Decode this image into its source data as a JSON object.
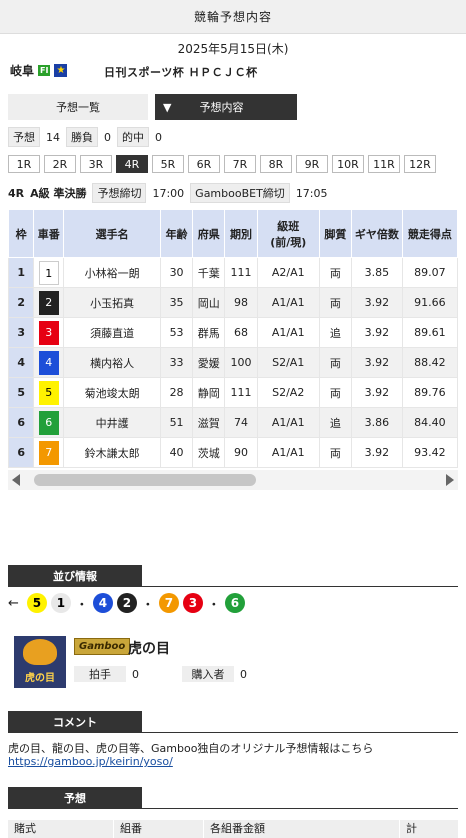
{
  "header": {
    "title": "競輪予想内容"
  },
  "date": "2025年5月15日(木)",
  "venue": {
    "name": "岐阜",
    "grade_badge": "FI",
    "star": "★",
    "cup": "日刊スポーツ杯 ＨＰＣＪＣ杯"
  },
  "tabs": {
    "list": "予想一覧",
    "detail_arrow": "▼",
    "detail": "予想内容"
  },
  "stats": {
    "yoso_label": "予想",
    "yoso": "14",
    "win_label": "勝負",
    "win": "0",
    "hit_label": "的中",
    "hit": "0"
  },
  "races": [
    "1R",
    "2R",
    "3R",
    "4R",
    "5R",
    "6R",
    "7R",
    "8R",
    "9R",
    "10R",
    "11R",
    "12R"
  ],
  "active_race": "4R",
  "raceinfo": {
    "race": "4R",
    "class": "A級 準決勝",
    "deadline_label": "予想締切",
    "deadline": "17:00",
    "bet_label": "GambooBET締切",
    "bet_deadline": "17:05"
  },
  "table": {
    "headers": [
      "枠",
      "車番",
      "選手名",
      "年齢",
      "府県",
      "期別",
      "級班\n(前/現)",
      "脚質",
      "ギヤ倍数",
      "競走得点"
    ],
    "rows": [
      {
        "waku": "1",
        "num": "1",
        "name": "小林裕一朗",
        "age": "30",
        "pref": "千葉",
        "term": "111",
        "rank": "A2/A1",
        "style": "両",
        "gear": "3.85",
        "score": "89.07"
      },
      {
        "waku": "2",
        "num": "2",
        "name": "小玉拓真",
        "age": "35",
        "pref": "岡山",
        "term": "98",
        "rank": "A1/A1",
        "style": "両",
        "gear": "3.92",
        "score": "91.66"
      },
      {
        "waku": "3",
        "num": "3",
        "name": "須藤直道",
        "age": "53",
        "pref": "群馬",
        "term": "68",
        "rank": "A1/A1",
        "style": "追",
        "gear": "3.92",
        "score": "89.61"
      },
      {
        "waku": "4",
        "num": "4",
        "name": "横内裕人",
        "age": "33",
        "pref": "愛媛",
        "term": "100",
        "rank": "S2/A1",
        "style": "両",
        "gear": "3.92",
        "score": "88.42"
      },
      {
        "waku": "5",
        "num": "5",
        "name": "菊池竣太朗",
        "age": "28",
        "pref": "静岡",
        "term": "111",
        "rank": "S2/A2",
        "style": "両",
        "gear": "3.92",
        "score": "89.76"
      },
      {
        "waku": "6",
        "num": "6",
        "name": "中井護",
        "age": "51",
        "pref": "滋賀",
        "term": "74",
        "rank": "A1/A1",
        "style": "追",
        "gear": "3.86",
        "score": "84.40"
      },
      {
        "waku": "6",
        "num": "7",
        "name": "鈴木謙太郎",
        "age": "40",
        "pref": "茨城",
        "term": "90",
        "rank": "A1/A1",
        "style": "両",
        "gear": "3.92",
        "score": "93.42"
      }
    ]
  },
  "colors": {
    "car1": "#ffffff",
    "car2": "#222222",
    "car3": "#e60012",
    "car4": "#1d4ed8",
    "car5": "#fff200",
    "car6": "#22a03a",
    "car7": "#f39800",
    "header_bg": "#d6dff3",
    "section_bg": "#333333"
  },
  "narabi": {
    "title": "並び情報",
    "arrow": "←",
    "groups": [
      [
        "5",
        "1"
      ],
      [
        "4",
        "2"
      ],
      [
        "7",
        "3"
      ],
      [
        "6"
      ]
    ],
    "dot": "・"
  },
  "gamboo": {
    "badge": "Gamboo",
    "name": "虎の目",
    "avatar_text": "虎の目",
    "clap_label": "拍手",
    "clap": "0",
    "buyer_label": "購入者",
    "buyer": "0"
  },
  "comment": {
    "title": "コメント",
    "text": "虎の目、龍の目、虎の目等、Gamboo独自のオリジナル予想情報はこちら",
    "link": "https://gamboo.jp/keirin/yoso/"
  },
  "yoso": {
    "title": "予想",
    "cols": [
      "賭式",
      "組番",
      "各組番金額",
      "計"
    ]
  }
}
